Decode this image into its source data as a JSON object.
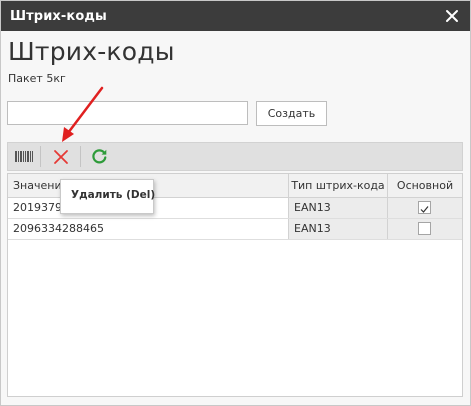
{
  "window": {
    "title": "Штрих-коды",
    "close_icon": "close-icon"
  },
  "page": {
    "heading": "Штрих-коды",
    "subtitle": "Пакет 5кг"
  },
  "form": {
    "input_value": "",
    "input_placeholder": "",
    "create_label": "Создать"
  },
  "toolbar": {
    "barcode_icon": "barcode-icon",
    "delete_icon": "delete-x-icon",
    "refresh_icon": "refresh-icon",
    "delete_color": "#e53935",
    "refresh_color": "#2e9b3a"
  },
  "tooltip": {
    "text": "Удалить (Del)"
  },
  "grid": {
    "columns": [
      "Значение",
      "Тип штрих-кода",
      "Основной"
    ],
    "rows": [
      {
        "value": "2019379",
        "type": "EAN13",
        "primary": true,
        "selected": true
      },
      {
        "value": "2096334288465",
        "type": "EAN13",
        "primary": false,
        "selected": false
      }
    ]
  },
  "annotation": {
    "arrow_color": "#e02020"
  }
}
